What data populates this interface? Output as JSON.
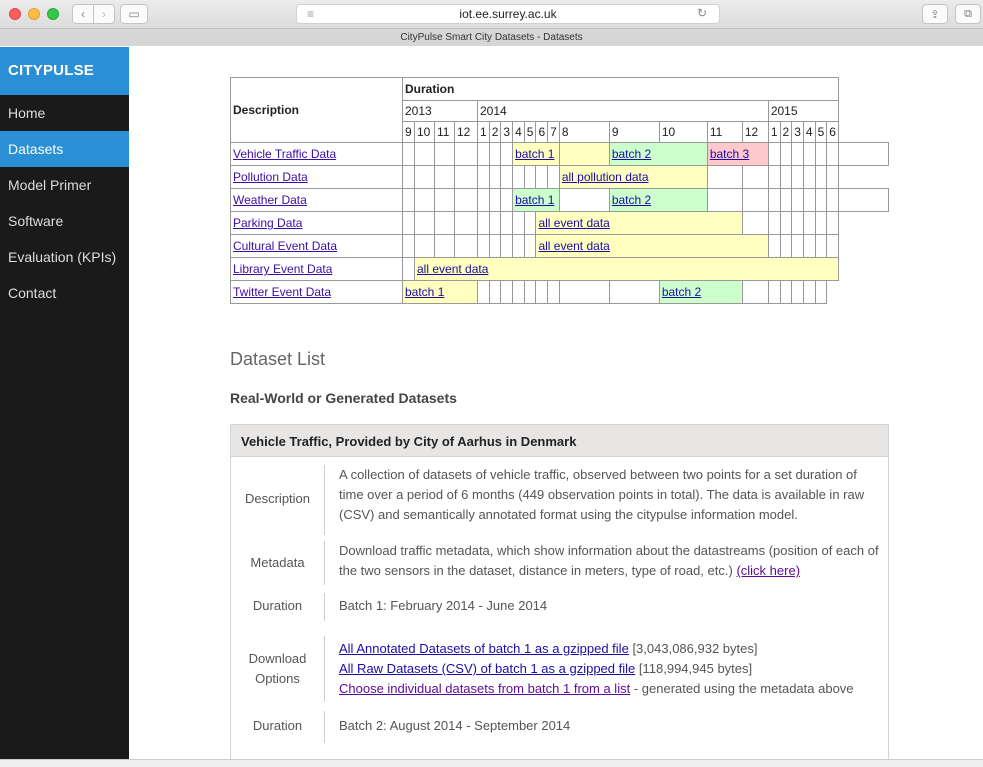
{
  "browser": {
    "url": "iot.ee.surrey.ac.uk",
    "tab_title": "CityPulse Smart City Datasets - Datasets",
    "back_glyph": "‹",
    "forward_glyph": "›",
    "sidebar_glyph": "▭",
    "menu_glyph": "≡",
    "reload_glyph": "↻",
    "share_glyph": "⇪",
    "tabs_glyph": "⧉"
  },
  "sidebar": {
    "brand": "CITYPULSE",
    "items": [
      {
        "label": "Home"
      },
      {
        "label": "Datasets"
      },
      {
        "label": "Model Primer"
      },
      {
        "label": "Software"
      },
      {
        "label": "Evaluation (KPIs)"
      },
      {
        "label": "Contact"
      }
    ],
    "active": "Datasets"
  },
  "timeline": {
    "description_header": "Description",
    "duration_header": "Duration",
    "years": [
      "2013",
      "2014",
      "2015"
    ],
    "months": [
      "9",
      "10",
      "11",
      "12",
      "1",
      "2",
      "3",
      "4",
      "5",
      "6",
      "7",
      "8",
      "9",
      "10",
      "11",
      "12",
      "1",
      "2",
      "3",
      "4",
      "5",
      "6"
    ],
    "rows": [
      {
        "label": "Vehicle Traffic Data",
        "bars": [
          "batch 1",
          "batch 2",
          "batch 3"
        ]
      },
      {
        "label": "Pollution Data",
        "bars": [
          "all pollution data"
        ]
      },
      {
        "label": "Weather Data",
        "bars": [
          "batch 1",
          "batch 2"
        ]
      },
      {
        "label": "Parking Data",
        "bars": [
          "all event data"
        ]
      },
      {
        "label": "Cultural Event Data",
        "bars": [
          "all event data"
        ]
      },
      {
        "label": "Library Event Data",
        "bars": [
          "all event data"
        ]
      },
      {
        "label": "Twitter Event Data",
        "bars": [
          "batch 1",
          "batch 2"
        ]
      }
    ],
    "colors": {
      "yellow": "#ffffc0",
      "green": "#ccffcc",
      "red": "#ffc8cc"
    }
  },
  "content": {
    "section_title": "Dataset List",
    "section_sub": "Real-World or Generated Datasets",
    "panel_title": "Vehicle Traffic, Provided by City of Aarhus in Denmark",
    "rows": {
      "description_label": "Description",
      "description_text": "A collection of datasets of vehicle traffic, observed between two points for a set duration of time over a period of 6 months (449 observation points in total). The data is available in raw (CSV) and semantically annotated format using the citypulse information model.",
      "metadata_label": "Metadata",
      "metadata_text": "Download traffic metadata, which show information about the datastreams (position of each of the two sensors in the dataset, distance in meters, type of road, etc.)",
      "metadata_link": "(click here)",
      "duration_label": "Duration",
      "duration_text_1": "Batch 1: February 2014 - June 2014",
      "download_label": "Download Options",
      "download_link_1": "All Annotated Datasets of batch 1 as a gzipped file",
      "download_size_1": "[3,043,086,932 bytes]",
      "download_link_2": "All Raw Datasets (CSV) of batch 1 as a gzipped file",
      "download_size_2": "[118,994,945 bytes]",
      "download_link_3": "Choose individual datasets from batch 1 from a list",
      "download_note_3": "- generated using the metadata above",
      "duration_label_2": "Duration",
      "duration_text_2": "Batch 2: August 2014 - September 2014"
    }
  }
}
